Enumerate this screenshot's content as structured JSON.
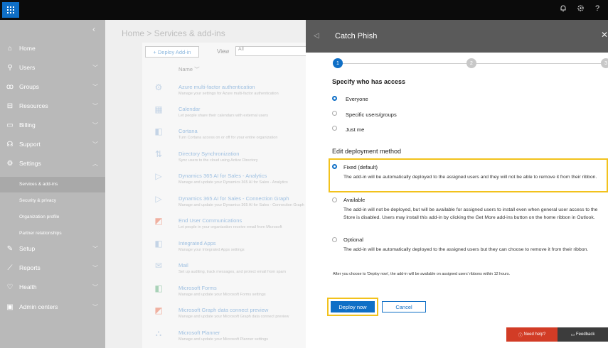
{
  "topbar": {
    "icons": [
      "bell-icon",
      "gear-icon",
      "help-icon"
    ],
    "help_glyph": "?"
  },
  "nav": {
    "items": [
      {
        "label": "Home",
        "icon": "home-icon"
      },
      {
        "label": "Users",
        "icon": "user-icon"
      },
      {
        "label": "Groups",
        "icon": "groups-icon"
      },
      {
        "label": "Resources",
        "icon": "resources-icon"
      },
      {
        "label": "Billing",
        "icon": "billing-icon"
      },
      {
        "label": "Support",
        "icon": "support-icon"
      },
      {
        "label": "Settings",
        "icon": "gear-icon"
      }
    ],
    "settings_sub": [
      "Services & add-ins",
      "Security & privacy",
      "Organization profile",
      "Partner relationships"
    ],
    "items2": [
      {
        "label": "Setup",
        "icon": "wrench-icon"
      },
      {
        "label": "Reports",
        "icon": "reports-icon"
      },
      {
        "label": "Health",
        "icon": "heart-icon"
      },
      {
        "label": "Admin centers",
        "icon": "admin-icon"
      }
    ]
  },
  "main": {
    "breadcrumb": "Home > Services & add-ins",
    "deploy_label": "+ Deploy Add-in",
    "view_label": "View",
    "view_value": "All",
    "name_header": "Name",
    "rows": [
      {
        "title": "Azure multi-factor authentication",
        "desc": "Manage your settings for Azure multi-factor authentication",
        "icon": "shield-icon"
      },
      {
        "title": "Calendar",
        "desc": "Let people share their calendars with external users",
        "icon": "calendar-icon"
      },
      {
        "title": "Cortana",
        "desc": "Turn Cortana access on or off for your entire organization",
        "icon": "cortana-icon"
      },
      {
        "title": "Directory Synchronization",
        "desc": "Sync users to the cloud using Active Directory",
        "icon": "sync-icon"
      },
      {
        "title": "Dynamics 365 AI for Sales - Analytics",
        "desc": "Manage and update your Dynamics 365 AI for Sales - Analytics",
        "icon": "dynamics-icon"
      },
      {
        "title": "Dynamics 365 AI for Sales - Connection Graph",
        "desc": "Manage and update your Dynamics 365 AI for Sales - Connection Graph",
        "icon": "dynamics-icon"
      },
      {
        "title": "End User Communications",
        "desc": "Let people in your organization receive email from Microsoft",
        "icon": "office-icon"
      },
      {
        "title": "Integrated Apps",
        "desc": "Manage your Integrated Apps settings",
        "icon": "apps-icon"
      },
      {
        "title": "Mail",
        "desc": "Set up auditing, track messages, and protect email from spam",
        "icon": "mail-icon"
      },
      {
        "title": "Microsoft Forms",
        "desc": "Manage and update your Microsoft Forms settings",
        "icon": "forms-icon"
      },
      {
        "title": "Microsoft Graph data connect preview",
        "desc": "Manage and update your Microsoft Graph data connect preview",
        "icon": "office-icon"
      },
      {
        "title": "Microsoft Planner",
        "desc": "Manage and update your Microsoft Planner settings",
        "icon": "planner-icon"
      }
    ]
  },
  "flyout": {
    "title": "Catch Phish",
    "steps": [
      "1",
      "2",
      "3"
    ],
    "access_heading": "Specify who has access",
    "access_options": [
      "Everyone",
      "Specific users/groups",
      "Just me"
    ],
    "method_heading": "Edit deployment method",
    "method_options": [
      {
        "label": "Fixed (default)",
        "desc": "The add-in will be automatically deployed to the assigned users and they will not be able to remove it from their ribbon."
      },
      {
        "label": "Available",
        "desc": "The add-in will not be deployed, but will be available for assigned users to install even when general user access to the Store is disabled. Users may install this add-in by clicking the Get More add-ins button on the home ribbon in Outlook."
      },
      {
        "label": "Optional",
        "desc": "The add-in will be automatically deployed to the assigned users but they can choose to remove it from their ribbon."
      }
    ],
    "note": "After you choose to 'Deploy now', the add-in will be available on assigned users' ribbons within 12 hours.",
    "deploy_label": "Deploy now",
    "cancel_label": "Cancel",
    "help_label": "Need help?",
    "feedback_label": "Feedback"
  },
  "colors": {
    "accent": "#0f6fc6",
    "highlight": "#f2c21c",
    "help": "#d23c26"
  }
}
